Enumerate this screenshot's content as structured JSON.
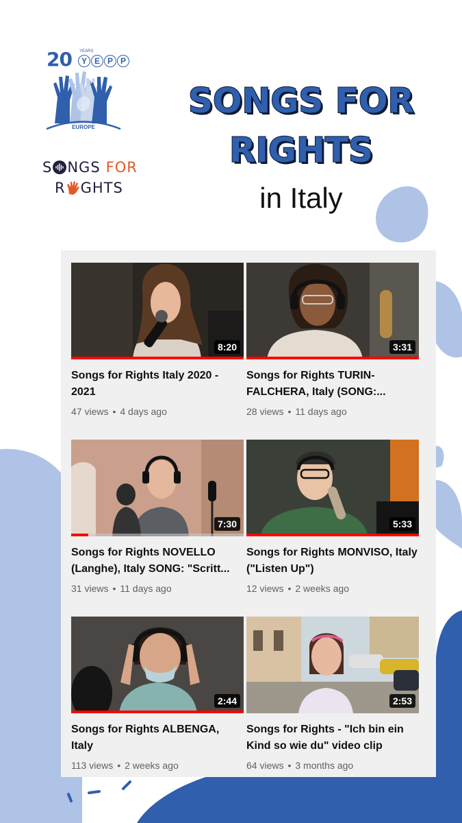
{
  "colors": {
    "brand_blue": "#2f5fad",
    "light_blue": "#aec3e6",
    "accent_orange": "#e3592a",
    "progress_red": "#ff0000"
  },
  "logos": {
    "yepp": {
      "number": "20",
      "years": "YEARS",
      "letters": [
        "Y",
        "E",
        "P",
        "P"
      ],
      "region": "EUROPE"
    },
    "songs_for_rights": {
      "line1_a": "S",
      "line1_b": "NGS",
      "line1_c": "FOR",
      "line2_a": "R",
      "line2_b": "GHTS"
    }
  },
  "header": {
    "title_line1": "SONGS FOR",
    "title_line2": "RIGHTS",
    "subtitle": "in Italy"
  },
  "videos": [
    {
      "title": "Songs for Rights Italy 2020 - 2021",
      "duration": "8:20",
      "views": "47 views",
      "age": "4 days ago",
      "watched_fraction": 1.0,
      "thumb_icon": "singer-with-microphone"
    },
    {
      "title": "Songs for Rights TURIN-FALCHERA, Italy (SONG:...",
      "duration": "3:31",
      "views": "28 views",
      "age": "11 days ago",
      "watched_fraction": 1.0,
      "thumb_icon": "singer-with-headphones"
    },
    {
      "title": "Songs for Rights NOVELLO (Langhe), Italy SONG: \"Scritt...",
      "duration": "7:30",
      "views": "31 views",
      "age": "11 days ago",
      "watched_fraction": 0.1,
      "thumb_icon": "singers-in-studio"
    },
    {
      "title": "Songs for Rights MONVISO, Italy (\"Listen Up\")",
      "duration": "5:33",
      "views": "12 views",
      "age": "2 weeks ago",
      "watched_fraction": 1.0,
      "thumb_icon": "singer-with-cap"
    },
    {
      "title": "Songs for Rights ALBENGA, Italy",
      "duration": "2:44",
      "views": "113 views",
      "age": "2 weeks ago",
      "watched_fraction": 1.0,
      "thumb_icon": "singer-with-mask"
    },
    {
      "title": "Songs for Rights - \"Ich bin ein Kind so wie du\" video clip",
      "duration": "2:53",
      "views": "64 views",
      "age": "3 months ago",
      "watched_fraction": 0,
      "thumb_icon": "child-in-street"
    }
  ]
}
